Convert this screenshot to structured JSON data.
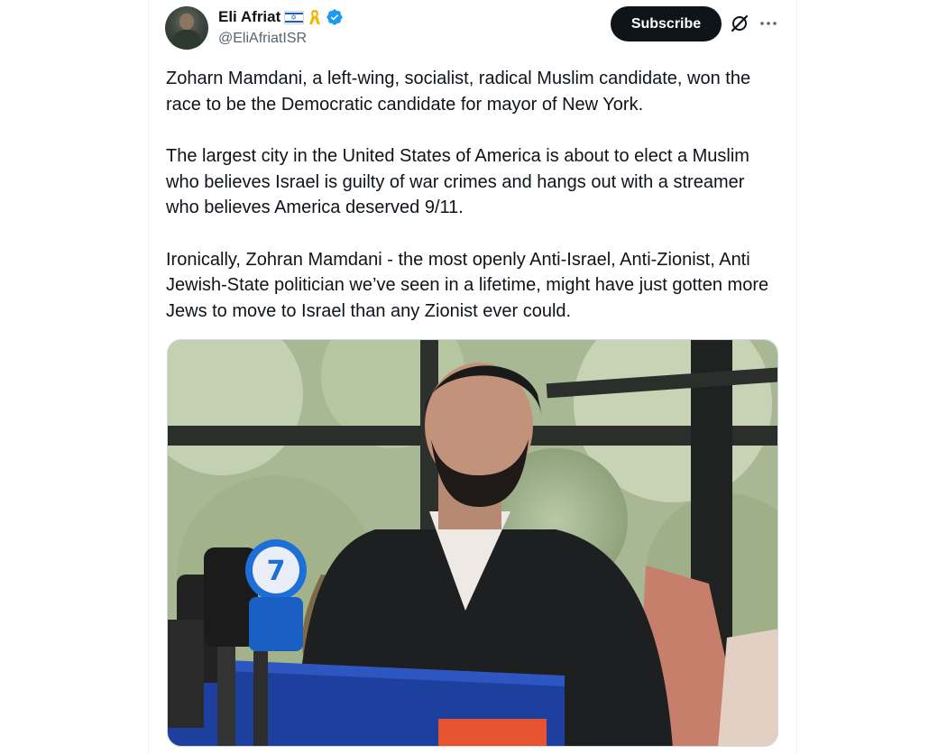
{
  "author": {
    "display_name": "Eli Afriat",
    "handle": "@EliAfriatISR",
    "badges": [
      "israel-flag-icon",
      "yellow-ribbon-icon",
      "verified-icon"
    ]
  },
  "actions": {
    "subscribe_label": "Subscribe",
    "grok_icon": "grok-icon",
    "more_icon": "more-icon"
  },
  "tweet": {
    "paragraphs": [
      "Zoharn Mamdani, a left-wing, socialist, radical Muslim candidate, won the race to be the Democratic candidate for mayor of New York.",
      "The largest city in the United States of America is about to elect a Muslim who believes Israel is guilty of war crimes and hangs out with a streamer who believes America deserved 9/11.",
      "Ironically, Zohran Mamdani - the most openly Anti-Israel, Anti-Zionist, Anti Jewish-State politician we’ve seen in a lifetime, might have just gotten more Jews to move to Israel than any Zionist ever could."
    ]
  },
  "colors": {
    "text": "#0f1419",
    "secondary": "#536471",
    "verified": "#1d9bf0",
    "subscribe_bg": "#0f1419"
  }
}
